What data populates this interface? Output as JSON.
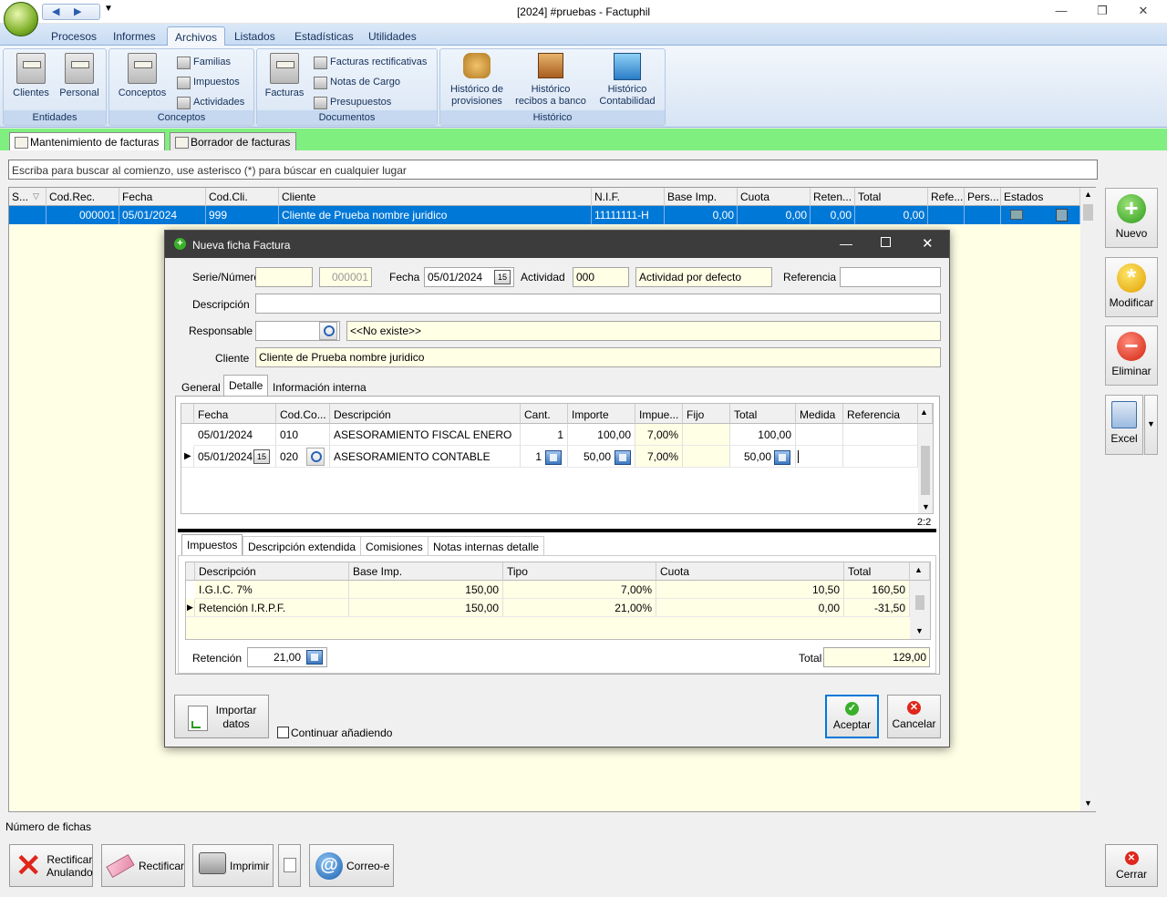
{
  "window": {
    "title": "[2024] #pruebas - Factuphil",
    "min": "—",
    "restore": "❐",
    "close": "✕"
  },
  "ribbon": {
    "tabs": [
      "Procesos",
      "Informes",
      "Archivos",
      "Listados",
      "Estadísticas",
      "Utilidades"
    ],
    "active_tab": "Archivos",
    "groups": {
      "entidades": {
        "label": "Entidades",
        "clientes": "Clientes",
        "personal": "Personal"
      },
      "conceptos": {
        "label": "Conceptos",
        "conceptos": "Conceptos",
        "familias": "Familias",
        "impuestos": "Impuestos",
        "actividades": "Actividades"
      },
      "documentos": {
        "label": "Documentos",
        "facturas": "Facturas",
        "rectificativas": "Facturas rectificativas",
        "notas_cargo": "Notas de Cargo",
        "presupuestos": "Presupuestos"
      },
      "historico": {
        "label": "Histórico",
        "provisiones": [
          "Histórico de",
          "provisiones"
        ],
        "recibos": [
          "Histórico",
          "recibos a banco"
        ],
        "contabilidad": [
          "Histórico",
          "Contabilidad"
        ]
      }
    }
  },
  "doc_tabs": [
    "Mantenimiento de facturas",
    "Borrador de facturas"
  ],
  "search": {
    "placeholder": "Escriba para buscar al comienzo, use asterisco (*) para búscar en cualquier lugar"
  },
  "main_grid": {
    "headers": [
      "S...",
      "Cod.Rec.",
      "Fecha",
      "Cod.Cli.",
      "Cliente",
      "N.I.F.",
      "Base Imp.",
      "Cuota",
      "Reten...",
      "Total",
      "Refe...",
      "Pers...",
      "Estados"
    ],
    "row": {
      "codrec": "000001",
      "fecha": "05/01/2024",
      "codcli": "999",
      "cliente": "Cliente de Prueba nombre juridico",
      "nif": "11111111-H",
      "base": "0,00",
      "cuota": "0,00",
      "reten": "0,00",
      "total": "0,00"
    }
  },
  "side_buttons": {
    "nuevo": "Nuevo",
    "modificar": "Modificar",
    "eliminar": "Eliminar",
    "excel": "Excel"
  },
  "footer": {
    "num_fichas": "Número de fichas",
    "rect_anulando": [
      "Rectificar",
      "Anulando"
    ],
    "rectificar": "Rectificar",
    "imprimir": "Imprimir",
    "correo": "Correo-e",
    "cerrar": "Cerrar"
  },
  "dialog": {
    "title": "Nueva ficha Factura",
    "labels": {
      "serie": "Serie/Número",
      "fecha": "Fecha",
      "actividad": "Actividad",
      "referencia": "Referencia",
      "descripcion": "Descripción",
      "responsable": "Responsable",
      "cliente": "Cliente"
    },
    "values": {
      "numero": "000001",
      "fecha": "05/01/2024",
      "actividad_cod": "000",
      "actividad_desc": "Actividad por defecto",
      "responsable_desc": "<<No existe>>",
      "cliente": "Cliente de Prueba nombre juridico"
    },
    "tabs": [
      "General",
      "Detalle",
      "Información interna"
    ],
    "detail": {
      "headers": [
        "Fecha",
        "Cod.Co...",
        "Descripción",
        "Cant.",
        "Importe",
        "Impue...",
        "Fijo",
        "Total",
        "Medida",
        "Referencia"
      ],
      "rows": [
        {
          "fecha": "05/01/2024",
          "cod": "010",
          "desc": "ASESORAMIENTO FISCAL ENERO",
          "cant": "1",
          "importe": "100,00",
          "impuesto": "7,00%",
          "total": "100,00"
        },
        {
          "fecha": "05/01/2024",
          "cod": "020",
          "desc": "ASESORAMIENTO CONTABLE",
          "cant": "1",
          "importe": "50,00",
          "impuesto": "7,00%",
          "total": "50,00"
        }
      ],
      "counter": "2:2"
    },
    "subtabs": [
      "Impuestos",
      "Descripción extendida",
      "Comisiones",
      "Notas internas detalle"
    ],
    "taxes": {
      "headers": [
        "Descripción",
        "Base Imp.",
        "Tipo",
        "Cuota",
        "Total"
      ],
      "rows": [
        {
          "desc": "I.G.I.C. 7%",
          "base": "150,00",
          "tipo": "7,00%",
          "cuota": "10,50",
          "total": "160,50"
        },
        {
          "desc": "Retención I.R.P.F.",
          "base": "150,00",
          "tipo": "21,00%",
          "cuota": "0,00",
          "total": "-31,50"
        }
      ]
    },
    "retencion_label": "Retención",
    "retencion": "21,00",
    "total_label": "Total",
    "total": "129,00",
    "importar": [
      "Importar",
      "datos"
    ],
    "continuar": "Continuar añadiendo",
    "aceptar": "Aceptar",
    "cancelar": "Cancelar"
  }
}
